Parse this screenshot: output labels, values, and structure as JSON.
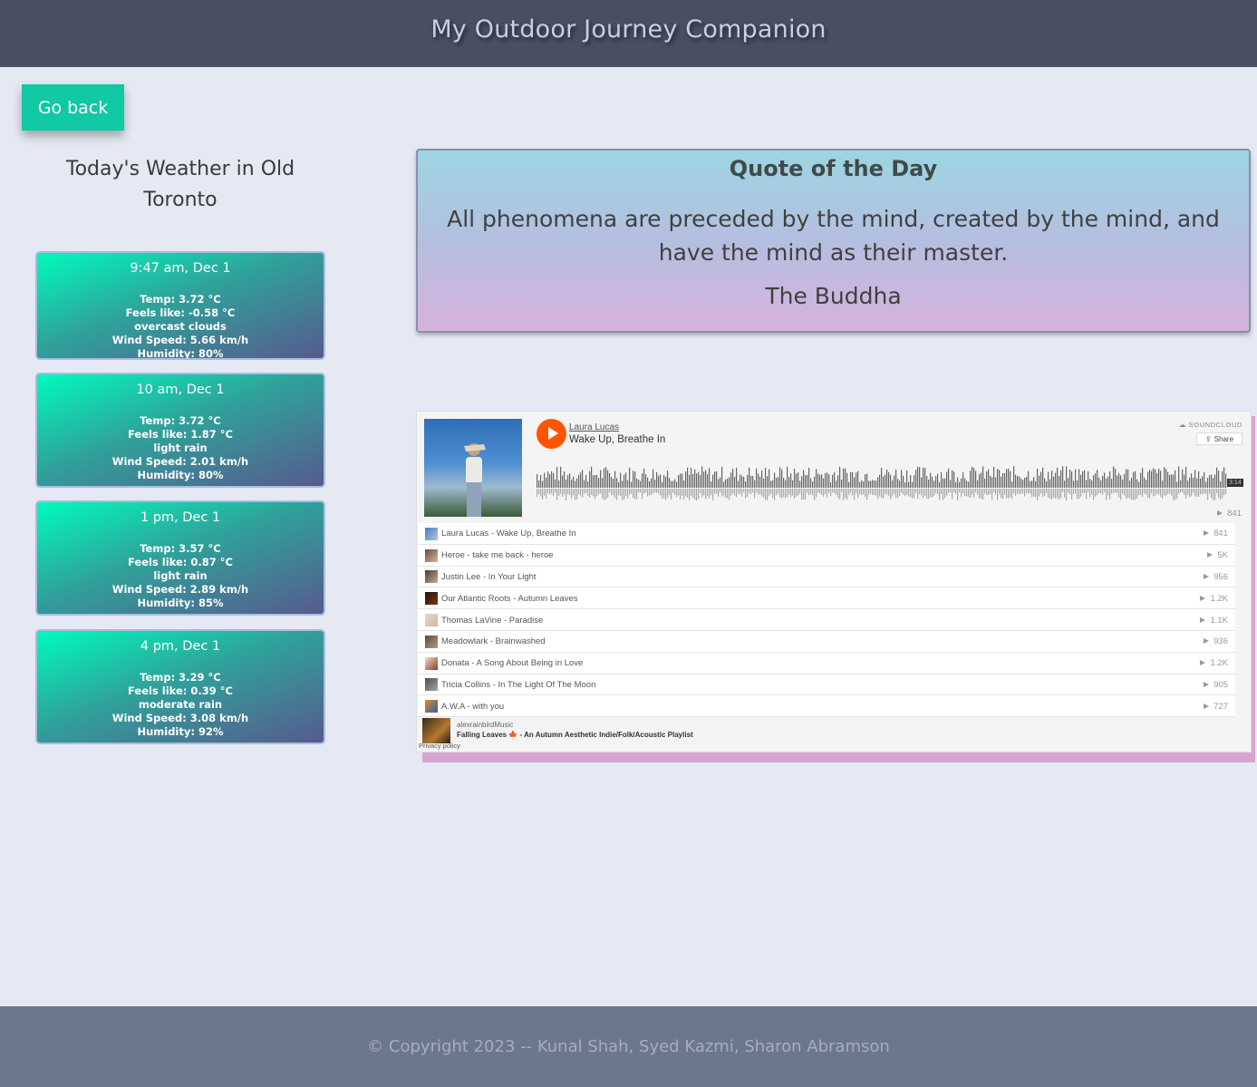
{
  "header": {
    "title": "My Outdoor Journey Companion"
  },
  "nav": {
    "go_back_label": "Go back"
  },
  "weather": {
    "title": "Today's Weather in Old Toronto",
    "forecasts": [
      {
        "time": "9:47 am, Dec 1",
        "temp": "Temp: 3.72 °C",
        "feels": "Feels like: -0.58 °C",
        "desc": "overcast clouds",
        "wind": "Wind Speed: 5.66 km/h",
        "humidity": "Humidity: 80%"
      },
      {
        "time": "10 am, Dec 1",
        "temp": "Temp: 3.72 °C",
        "feels": "Feels like: 1.87 °C",
        "desc": "light rain",
        "wind": "Wind Speed: 2.01 km/h",
        "humidity": "Humidity: 80%"
      },
      {
        "time": "1 pm, Dec 1",
        "temp": "Temp: 3.57 °C",
        "feels": "Feels like: 0.87 °C",
        "desc": "light rain",
        "wind": "Wind Speed: 2.89 km/h",
        "humidity": "Humidity: 85%"
      },
      {
        "time": "4 pm, Dec 1",
        "temp": "Temp: 3.29 °C",
        "feels": "Feels like: 0.39 °C",
        "desc": "moderate rain",
        "wind": "Wind Speed: 3.08 km/h",
        "humidity": "Humidity: 92%"
      }
    ]
  },
  "quote": {
    "title": "Quote of the Day",
    "text": "All phenomena are preceded by the mind, created by the mind, and have the mind as their master.",
    "author": "The Buddha"
  },
  "player": {
    "artist": "Laura Lucas",
    "track": "Wake Up, Breathe In",
    "brand": "SOUNDCLOUD",
    "share_label": "Share",
    "duration": "3:14",
    "play_count": "841",
    "accent_color": "#ff5500",
    "tracks": [
      {
        "title": "Laura Lucas - Wake Up, Breathe In",
        "plays": "841"
      },
      {
        "title": "Heroe - take me back - heroe",
        "plays": "5K"
      },
      {
        "title": "Justin Lee - In Your Light",
        "plays": "956"
      },
      {
        "title": "Our Atlantic Roots - Autumn Leaves",
        "plays": "1.2K"
      },
      {
        "title": "Thomas LaVine - Paradise",
        "plays": "1.1K"
      },
      {
        "title": "Meadowlark - Brainwashed",
        "plays": "936"
      },
      {
        "title": "Donata - A Song About Being in Love",
        "plays": "1.2K"
      },
      {
        "title": "Tricia Collins - In The Light Of The Moon",
        "plays": "905"
      },
      {
        "title": "A.W.A - with you",
        "plays": "727"
      }
    ],
    "playlist_user": "alexrainbirdMusic",
    "playlist_name": "Falling Leaves 🍁 - An Autumn Aesthetic Indie/Folk/Acoustic Playlist",
    "privacy_label": "Privacy policy"
  },
  "footer": {
    "text": "© Copyright 2023 -- Kunal Shah, Syed Kazmi, Sharon Abramson"
  }
}
